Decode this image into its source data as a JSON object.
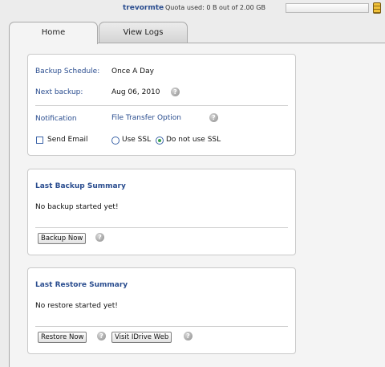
{
  "topbar": {
    "username": "trevormte",
    "quota_text": "Quota used: 0 B out of 2.00 GB",
    "quota_used_fraction": 0
  },
  "tabs": [
    {
      "label": "Home",
      "active": true
    },
    {
      "label": "View Logs",
      "active": false
    }
  ],
  "schedule": {
    "backup_schedule_label": "Backup Schedule:",
    "backup_schedule_value": "Once A Day",
    "next_backup_label": "Next backup:",
    "next_backup_value": "Aug 06, 2010",
    "notification_label": "Notification",
    "file_transfer_label": "File Transfer Option",
    "send_email_label": "Send Email",
    "send_email_checked": false,
    "use_ssl_label": "Use SSL",
    "no_ssl_label": "Do not use SSL",
    "selected_option": "Do not use SSL"
  },
  "backup_summary": {
    "title": "Last Backup Summary",
    "status": "No backup started yet!",
    "button_label": "Backup Now"
  },
  "restore_summary": {
    "title": "Last Restore Summary",
    "status": "No restore started yet!",
    "restore_button_label": "Restore Now",
    "visit_button_label": "Visit IDrive Web"
  },
  "icons": {
    "help": "help-icon",
    "quota": "database-icon"
  },
  "colors": {
    "label_blue": "#2a4d8f",
    "radio_selected": "#3aa34d"
  }
}
